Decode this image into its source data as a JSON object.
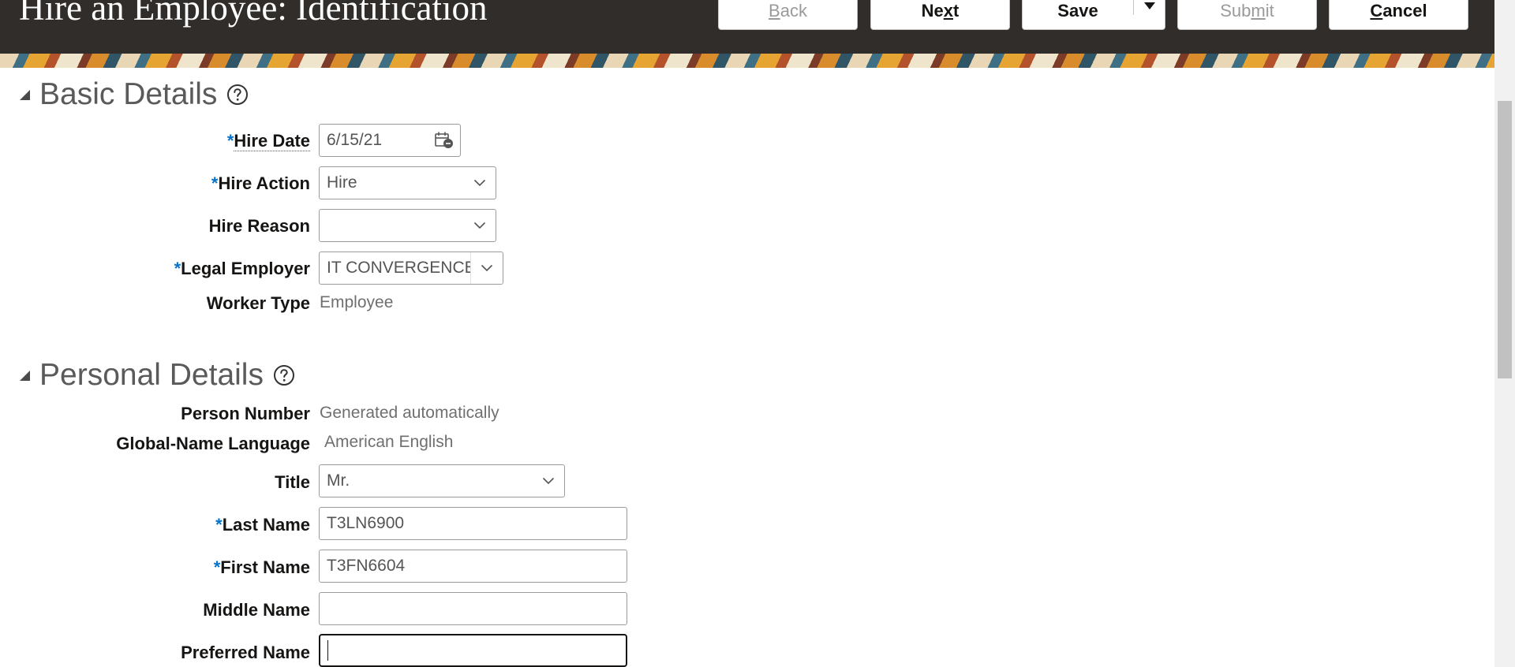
{
  "header": {
    "title": "Hire an Employee: Identification",
    "buttons": {
      "back": {
        "pre": "",
        "key": "B",
        "post": "ack"
      },
      "next": {
        "pre": "Ne",
        "key": "x",
        "post": "t"
      },
      "save": "Save",
      "submit": {
        "pre": "Sub",
        "key": "m",
        "post": "it"
      },
      "cancel": {
        "pre": "",
        "key": "C",
        "post": "ancel"
      }
    }
  },
  "basic_details": {
    "title": "Basic Details",
    "hire_date": {
      "label": "Hire Date",
      "value": "6/15/21"
    },
    "hire_action": {
      "label": "Hire Action",
      "value": "Hire"
    },
    "hire_reason": {
      "label": "Hire Reason",
      "value": ""
    },
    "legal_employer": {
      "label": "Legal Employer",
      "value": "IT CONVERGENCE CAD"
    },
    "worker_type": {
      "label": "Worker Type",
      "value": "Employee"
    }
  },
  "personal_details": {
    "title": "Personal Details",
    "person_number": {
      "label": "Person Number",
      "value": "Generated automatically"
    },
    "global_name_language": {
      "label": "Global-Name Language",
      "value": "American English"
    },
    "title_field": {
      "label": "Title",
      "value": "Mr."
    },
    "last_name": {
      "label": "Last Name",
      "value": "T3LN6900"
    },
    "first_name": {
      "label": "First Name",
      "value": "T3FN6604"
    },
    "middle_name": {
      "label": "Middle Name",
      "value": ""
    },
    "preferred_name": {
      "label": "Preferred Name",
      "value": ""
    }
  },
  "required_marker": "*",
  "icons": {
    "calendar": "calendar-icon",
    "chevron": "chevron-down-icon",
    "help": "help-icon",
    "disclosure": "disclosure-expanded-icon"
  },
  "colors": {
    "header_bg": "#312d2a",
    "required": "#0572ce",
    "section_title": "#5a5a5a"
  }
}
